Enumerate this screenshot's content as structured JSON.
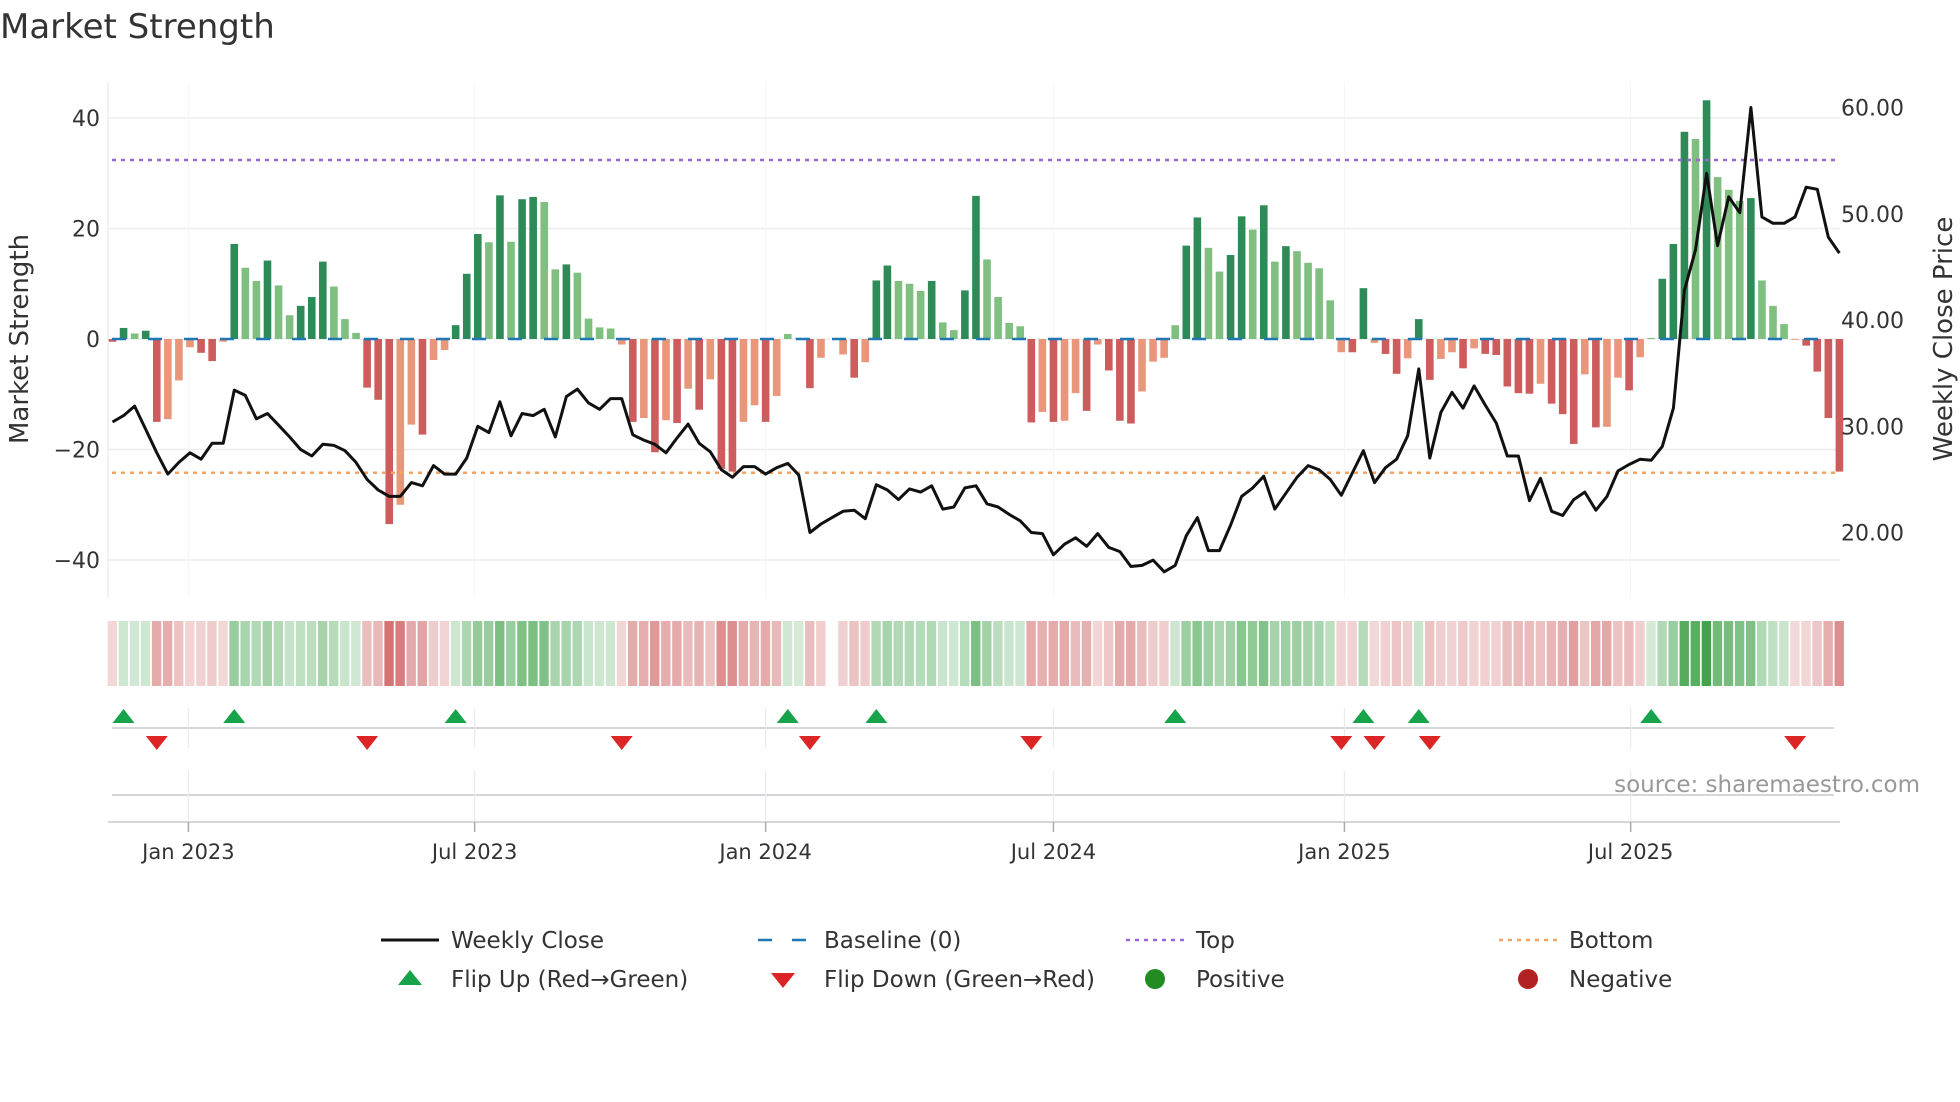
{
  "chart_data": {
    "type": "bar",
    "title": "Market Strength",
    "ylabel": "Market Strength",
    "ylabel_right": "Weekly Close Price",
    "ylim": [
      -46,
      46
    ],
    "ylim_right": [
      13.5,
      63.5
    ],
    "yticks": [
      {
        "v": 40,
        "label": "40"
      },
      {
        "v": 20,
        "label": "20"
      },
      {
        "v": 0,
        "label": "0"
      },
      {
        "v": -20,
        "label": "−20"
      },
      {
        "v": -40,
        "label": "−40"
      }
    ],
    "yticks_right": [
      {
        "v": 60,
        "label": "60.00"
      },
      {
        "v": 50,
        "label": "50.00"
      },
      {
        "v": 40,
        "label": "40.00"
      },
      {
        "v": 30,
        "label": "30.00"
      },
      {
        "v": 20,
        "label": "20.00"
      }
    ],
    "xticks": [
      {
        "date": "2023-01-01",
        "label": "Jan 2023"
      },
      {
        "date": "2023-07-01",
        "label": "Jul 2023"
      },
      {
        "date": "2024-01-01",
        "label": "Jan 2024"
      },
      {
        "date": "2024-07-01",
        "label": "Jul 2024"
      },
      {
        "date": "2025-01-01",
        "label": "Jan 2025"
      },
      {
        "date": "2025-07-01",
        "label": "Jul 2025"
      }
    ],
    "grid": true,
    "top_level": 32.4,
    "bottom_level": -24.2,
    "baseline": 0,
    "dates": [
      "2022-11-14",
      "2022-11-21",
      "2022-11-28",
      "2022-12-05",
      "2022-12-12",
      "2022-12-19",
      "2022-12-26",
      "2023-01-02",
      "2023-01-09",
      "2023-01-16",
      "2023-01-23",
      "2023-01-30",
      "2023-02-06",
      "2023-02-13",
      "2023-02-20",
      "2023-02-27",
      "2023-03-06",
      "2023-03-13",
      "2023-03-20",
      "2023-03-27",
      "2023-04-03",
      "2023-04-10",
      "2023-04-17",
      "2023-04-24",
      "2023-05-01",
      "2023-05-08",
      "2023-05-15",
      "2023-05-22",
      "2023-05-29",
      "2023-06-05",
      "2023-06-12",
      "2023-06-19",
      "2023-06-26",
      "2023-07-03",
      "2023-07-10",
      "2023-07-17",
      "2023-07-24",
      "2023-07-31",
      "2023-08-07",
      "2023-08-14",
      "2023-08-21",
      "2023-08-28",
      "2023-09-04",
      "2023-09-11",
      "2023-09-18",
      "2023-09-25",
      "2023-10-02",
      "2023-10-09",
      "2023-10-16",
      "2023-10-23",
      "2023-10-30",
      "2023-11-06",
      "2023-11-13",
      "2023-11-20",
      "2023-11-27",
      "2023-12-04",
      "2023-12-11",
      "2023-12-18",
      "2023-12-25",
      "2024-01-01",
      "2024-01-08",
      "2024-01-15",
      "2024-01-22",
      "2024-01-29",
      "2024-02-05",
      "2024-02-12",
      "2024-02-19",
      "2024-02-26",
      "2024-03-04",
      "2024-03-11",
      "2024-03-18",
      "2024-03-25",
      "2024-04-01",
      "2024-04-08",
      "2024-04-15",
      "2024-04-22",
      "2024-04-29",
      "2024-05-06",
      "2024-05-13",
      "2024-05-20",
      "2024-05-27",
      "2024-06-03",
      "2024-06-10",
      "2024-06-17",
      "2024-06-24",
      "2024-07-01",
      "2024-07-08",
      "2024-07-15",
      "2024-07-22",
      "2024-07-29",
      "2024-08-05",
      "2024-08-12",
      "2024-08-19",
      "2024-08-26",
      "2024-09-02",
      "2024-09-09",
      "2024-09-16",
      "2024-09-23",
      "2024-09-30",
      "2024-10-07",
      "2024-10-14",
      "2024-10-21",
      "2024-10-28",
      "2024-11-04",
      "2024-11-11",
      "2024-11-18",
      "2024-11-25",
      "2024-12-02",
      "2024-12-09",
      "2024-12-16",
      "2024-12-23",
      "2024-12-30",
      "2025-01-06",
      "2025-01-13",
      "2025-01-20",
      "2025-01-27",
      "2025-02-03",
      "2025-02-10",
      "2025-02-17",
      "2025-02-24",
      "2025-03-03",
      "2025-03-10",
      "2025-03-17",
      "2025-03-24",
      "2025-03-31",
      "2025-04-07",
      "2025-04-14",
      "2025-04-21",
      "2025-04-28",
      "2025-05-05",
      "2025-05-12",
      "2025-05-19",
      "2025-05-26",
      "2025-06-02",
      "2025-06-09",
      "2025-06-16",
      "2025-06-23",
      "2025-06-30",
      "2025-07-07",
      "2025-07-14",
      "2025-07-21",
      "2025-07-28",
      "2025-08-04",
      "2025-08-11",
      "2025-08-18",
      "2025-08-25",
      "2025-09-01",
      "2025-09-08",
      "2025-09-15",
      "2025-09-22",
      "2025-09-29",
      "2025-10-06",
      "2025-10-13",
      "2025-10-20",
      "2025-10-27",
      "2025-11-03",
      "2025-11-10"
    ],
    "series": [
      {
        "name": "Market Strength",
        "kind": "bar",
        "values": [
          -0.5,
          2,
          1,
          1.5,
          -15,
          -14.5,
          -7.5,
          -1.5,
          -2.5,
          -4,
          -0.5,
          17.2,
          12.9,
          10.5,
          14.2,
          9.7,
          4.3,
          6,
          7.6,
          14,
          9.5,
          3.6,
          1.1,
          -8.8,
          -11,
          -33.5,
          -30,
          -15.5,
          -17.3,
          -3.8,
          -2,
          2.5,
          11.8,
          19,
          17.5,
          26,
          17.6,
          25.3,
          25.7,
          24.8,
          12.6,
          13.5,
          12,
          3.7,
          2.1,
          1.9,
          -1,
          -15,
          -14.3,
          -20.5,
          -14.7,
          -15.2,
          -9,
          -12.8,
          -7.3,
          -23.5,
          -24,
          -15,
          -12,
          -15,
          -10.3,
          0.9,
          0.2,
          -8.9,
          -3.4,
          null,
          -2.8,
          -7,
          -4.2,
          10.6,
          13.3,
          10.5,
          10,
          8.7,
          10.5,
          3,
          1.6,
          8.8,
          25.9,
          14.4,
          7.6,
          2.9,
          2.3,
          -15.1,
          -13.2,
          -15,
          -14.8,
          -9.8,
          -13,
          -1,
          -5.7,
          -14.8,
          -15.3,
          -9.5,
          -4.1,
          -3.4,
          2.5,
          16.9,
          22,
          16.5,
          12.2,
          15.2,
          22.2,
          19.8,
          24.2,
          14,
          16.8,
          15.9,
          13.8,
          12.8,
          7,
          -2.4,
          -2.4,
          9.2,
          -0.7,
          -2.7,
          -6.3,
          -3.5,
          3.6,
          -7.4,
          -3.6,
          -2.4,
          -5.3,
          -1.7,
          -2.7,
          -2.9,
          -8.6,
          -9.8,
          -9.9,
          -8.1,
          -11.7,
          -13.6,
          -19,
          -6.4,
          -16,
          -15.9,
          -7,
          -9.3,
          -3.3,
          0.2,
          10.9,
          17.2,
          37.5,
          36.2,
          43.2,
          29.3,
          27,
          25,
          25.5,
          10.6,
          6,
          2.7,
          -0.1,
          -1.2,
          -5.9,
          -14.3,
          -24
        ]
      },
      {
        "name": "Weekly Close",
        "kind": "line",
        "axis": "right",
        "values": [
          30.4,
          31.0,
          31.9,
          29.7,
          27.5,
          25.5,
          26.6,
          27.5,
          26.9,
          28.4,
          28.4,
          33.4,
          32.9,
          30.7,
          31.2,
          30.1,
          29.0,
          27.8,
          27.2,
          28.3,
          28.2,
          27.7,
          26.6,
          25.0,
          24.0,
          23.4,
          23.4,
          24.7,
          24.4,
          26.3,
          25.5,
          25.5,
          27.0,
          30.0,
          29.4,
          32.3,
          29.1,
          31.2,
          31.0,
          31.6,
          29.0,
          32.8,
          33.5,
          32.2,
          31.6,
          32.6,
          32.6,
          29.2,
          28.7,
          28.3,
          27.5,
          28.9,
          30.2,
          28.4,
          27.6,
          25.9,
          25.2,
          26.2,
          26.2,
          25.5,
          26.1,
          26.5,
          25.4,
          20.0,
          20.8,
          21.4,
          22.0,
          22.1,
          21.3,
          24.5,
          24.0,
          23.1,
          24.1,
          23.8,
          24.4,
          22.2,
          22.4,
          24.2,
          24.4,
          22.7,
          22.4,
          21.7,
          21.1,
          20.0,
          19.9,
          17.9,
          18.9,
          19.5,
          18.7,
          19.9,
          18.6,
          18.2,
          16.8,
          16.9,
          17.4,
          16.3,
          16.9,
          19.7,
          21.4,
          18.3,
          18.3,
          20.7,
          23.4,
          24.2,
          25.3,
          22.2,
          23.7,
          25.2,
          26.3,
          25.9,
          25.0,
          23.5,
          25.6,
          27.7,
          24.7,
          26.1,
          26.9,
          29.1,
          35.4,
          27.0,
          31.3,
          33.2,
          31.7,
          33.8,
          32.0,
          30.3,
          27.2,
          27.2,
          23.0,
          25.1,
          22.0,
          21.6,
          23.1,
          23.8,
          22.1,
          23.4,
          25.8,
          26.4,
          26.9,
          26.8,
          28.1,
          31.7,
          42.8,
          46.6,
          53.8,
          47.0,
          51.6,
          50.1,
          60.0,
          49.7,
          49.1,
          49.1,
          49.7,
          52.5,
          52.3,
          47.8,
          46.3
        ]
      }
    ],
    "flip_up_dates": [
      "2022-11-21",
      "2023-01-30",
      "2023-06-19",
      "2024-01-15",
      "2024-03-11",
      "2024-09-16",
      "2025-01-13",
      "2025-02-17",
      "2025-07-14"
    ],
    "flip_down_dates": [
      "2022-12-12",
      "2023-04-24",
      "2023-10-02",
      "2024-01-29",
      "2024-06-17",
      "2024-12-30",
      "2025-01-20",
      "2025-02-24",
      "2025-10-13"
    ],
    "colors": {
      "green_rising": "#2e8b57",
      "green_falling": "#7fbf7f",
      "red_rising": "#cd5c5c",
      "red_falling": "#e9967a",
      "baseline": "#1f77b4",
      "top": "#9966dd",
      "bottom": "#f4a460",
      "line": "#111111",
      "flip_up": "#16a34a",
      "flip_down": "#dc2626",
      "positive": "#228b22",
      "negative": "#b22222"
    },
    "legend": {
      "placement": "bottom",
      "items": [
        {
          "label": "Weekly Close",
          "symbol": "line"
        },
        {
          "label": "Baseline (0)",
          "symbol": "dash"
        },
        {
          "label": "Top",
          "symbol": "dot-purple"
        },
        {
          "label": "Bottom",
          "symbol": "dot-orange"
        },
        {
          "label": "Flip Up (Red→Green)",
          "symbol": "triangle-up"
        },
        {
          "label": "Flip Down (Green→Red)",
          "symbol": "triangle-down"
        },
        {
          "label": "Positive",
          "symbol": "circle-green"
        },
        {
          "label": "Negative",
          "symbol": "circle-red"
        }
      ]
    },
    "source": "source: sharemaestro.com"
  }
}
